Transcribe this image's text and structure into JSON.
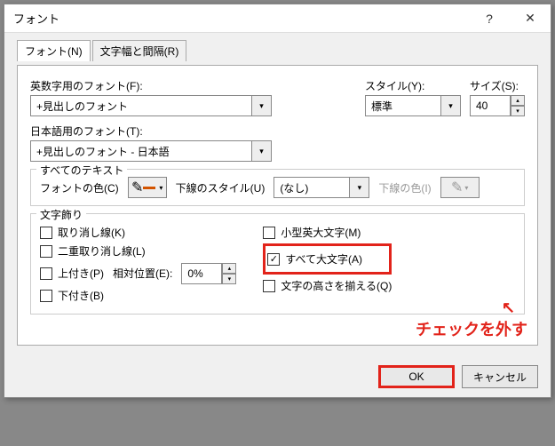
{
  "title": "フォント",
  "tabs": {
    "font": "フォント(N)",
    "spacing": "文字幅と間隔(R)"
  },
  "labels": {
    "latinFont": "英数字用のフォント(F):",
    "style": "スタイル(Y):",
    "size": "サイズ(S):",
    "asianFont": "日本語用のフォント(T):",
    "allText": "すべてのテキスト",
    "fontColor": "フォントの色(C)",
    "underlineStyle": "下線のスタイル(U)",
    "underlineColor": "下線の色(I)",
    "effects": "文字飾り",
    "offset": "相対位置(E):"
  },
  "values": {
    "latinFont": "+見出しのフォント",
    "asianFont": "+見出しのフォント - 日本語",
    "style": "標準",
    "size": "40",
    "underline": "(なし)",
    "offset": "0%"
  },
  "checks": {
    "strike": "取り消し線(K)",
    "dstrike": "二重取り消し線(L)",
    "super": "上付き(P)",
    "sub": "下付き(B)",
    "smallcaps": "小型英大文字(M)",
    "allcaps": "すべて大文字(A)",
    "equalize": "文字の高さを揃える(Q)"
  },
  "checked": {
    "allcaps": true
  },
  "annotation": "チェックを外す",
  "buttons": {
    "ok": "OK",
    "cancel": "キャンセル"
  },
  "icons": {
    "help": "?",
    "close": "✕",
    "down": "▾",
    "up": "▴",
    "check": "✓",
    "pen": "✎"
  },
  "chart_data": null
}
